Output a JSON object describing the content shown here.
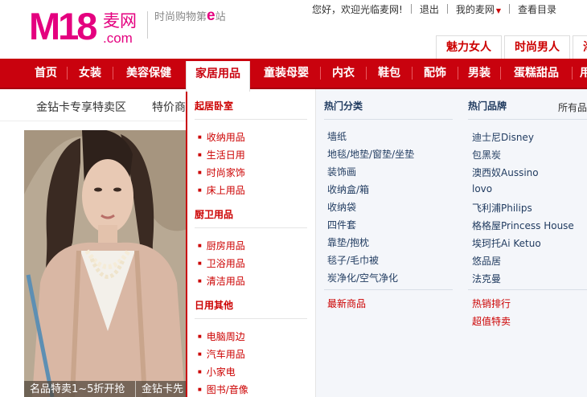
{
  "header": {
    "logo_mark": "M18",
    "logo_cn": "麦网",
    "logo_com": ".com",
    "slogan_prefix": "时尚购物第",
    "slogan_e": "e",
    "slogan_suffix": "站",
    "greeting": "您好，欢迎光临麦网!",
    "logout": "退出",
    "my_m18": "我的麦网",
    "catalog": "查看目录",
    "gender_tabs": [
      "魅力女人",
      "时尚男人",
      "海"
    ]
  },
  "nav": {
    "items": [
      "首页",
      "女装",
      "美容保健",
      "家居用品",
      "童装母婴",
      "内衣",
      "鞋包",
      "配饰",
      "男装",
      "蛋糕甜品",
      "用"
    ],
    "active_index": 3
  },
  "subnav": {
    "items": [
      "金钻卡专享特卖区",
      "特价商"
    ]
  },
  "banner": {
    "captions": [
      "名品特卖1~5折开抢",
      "金钻卡先"
    ]
  },
  "dropdown": {
    "left": {
      "groups": [
        {
          "title": "起居卧室",
          "links": [
            "收纳用品",
            "生活日用",
            "时尚家饰",
            "床上用品"
          ]
        },
        {
          "title": "厨卫用品",
          "links": [
            "厨房用品",
            "卫浴用品",
            "清洁用品"
          ]
        },
        {
          "title": "日用其他",
          "links": [
            "电脑周边",
            "汽车用品",
            "小家电",
            "图书/音像"
          ]
        }
      ]
    },
    "middle": {
      "title": "热门分类",
      "links": [
        "墙纸",
        "地毯/地垫/窗垫/坐垫",
        "装饰画",
        "收纳盒/箱",
        "收纳袋",
        "四件套",
        "靠垫/抱枕",
        "毯子/毛巾被",
        "炭净化/空气净化"
      ],
      "footer_link": "最新商品"
    },
    "right": {
      "title": "热门品牌",
      "all_brands": "所有品",
      "links": [
        "迪士尼Disney",
        "包黑炭",
        "澳西奴Aussino",
        "lovo",
        "飞利浦Philips",
        "格格屋Princess House",
        "埃珂托Ai Ketuo",
        "悠品居",
        "法克曼"
      ],
      "footer_links": [
        "热销排行",
        "超值特卖"
      ]
    }
  },
  "colors": {
    "brand_red": "#c9020e",
    "brand_pink": "#e4007f",
    "link_navy": "#1f3a5f",
    "panel_bg": "#f4f6fa"
  }
}
